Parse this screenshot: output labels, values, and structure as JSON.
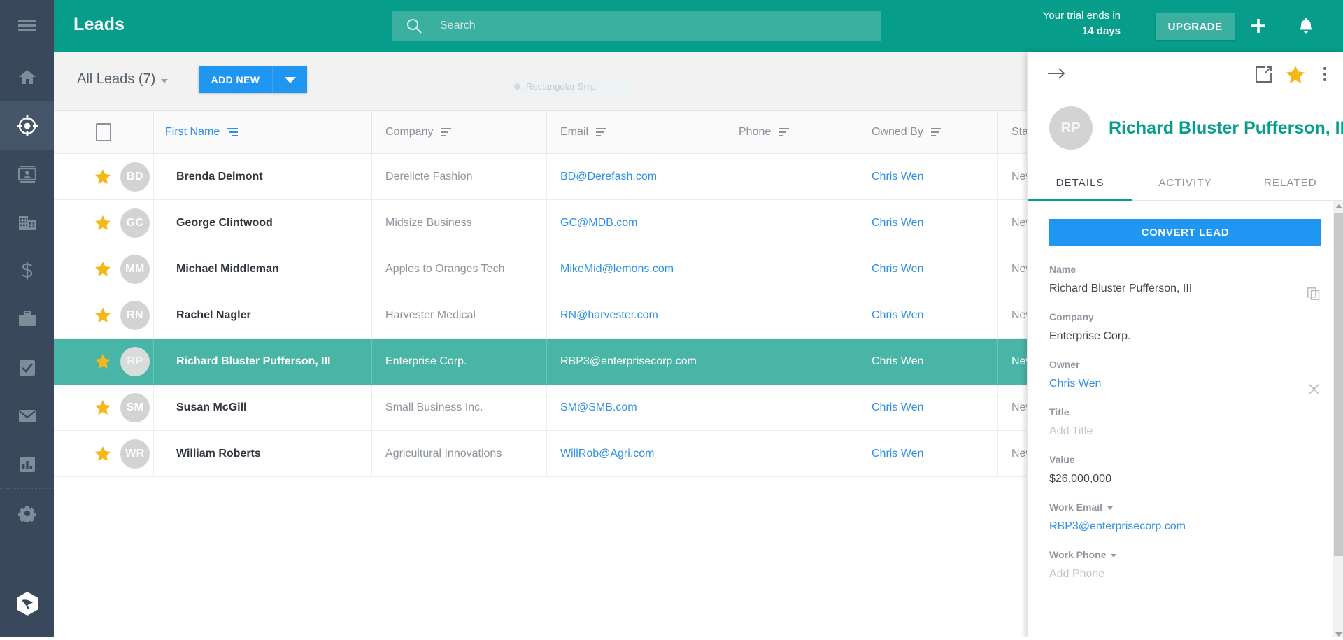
{
  "sidebar": {
    "items": [
      {
        "name": "menu-toggle",
        "icon": "hamburger-icon",
        "label": "Menu"
      },
      {
        "name": "home",
        "icon": "home-icon",
        "label": "Home"
      },
      {
        "name": "leads",
        "icon": "target-icon",
        "label": "Leads"
      },
      {
        "name": "contacts",
        "icon": "contact-card-icon",
        "label": "Contacts"
      },
      {
        "name": "accounts",
        "icon": "building-icon",
        "label": "Accounts"
      },
      {
        "name": "deals",
        "icon": "dollar-icon",
        "label": "Deals"
      },
      {
        "name": "projects",
        "icon": "briefcase-icon",
        "label": "Projects"
      },
      {
        "name": "tasks",
        "icon": "checkbox-icon",
        "label": "Tasks"
      },
      {
        "name": "email",
        "icon": "envelope-icon",
        "label": "Email"
      },
      {
        "name": "reports",
        "icon": "bar-chart-icon",
        "label": "Reports"
      },
      {
        "name": "settings",
        "icon": "gear-icon",
        "label": "Settings"
      },
      {
        "name": "logo",
        "icon": "leaf-hexagon-logo-icon",
        "label": "Logo"
      }
    ],
    "active": "leads",
    "bg_color": "#39485a",
    "active_bg_color": "#45556a"
  },
  "topbar": {
    "title": "Leads",
    "bg_color": "#069d8a",
    "search": {
      "value": "",
      "placeholder": "Search",
      "icon": "search-icon"
    },
    "trial_line1": "Your trial ends in",
    "trial_line2": "14 days",
    "upgrade_label": "UPGRADE",
    "plus_icon": "plus-icon",
    "bell_icon": "bell-icon"
  },
  "toolbar": {
    "view_label": "All Leads (7)",
    "add_new_label": "ADD NEW",
    "add_new_caret_icon": "chevron-down-icon",
    "accent_color": "#1e96f2",
    "snip_overlay_label": "Rectangular Snip"
  },
  "table": {
    "columns": [
      {
        "key": "check",
        "label": "",
        "sorted": false
      },
      {
        "key": "first_name",
        "label": "First Name",
        "sorted": true
      },
      {
        "key": "company",
        "label": "Company",
        "sorted": false
      },
      {
        "key": "email",
        "label": "Email",
        "sorted": false
      },
      {
        "key": "phone",
        "label": "Phone",
        "sorted": false
      },
      {
        "key": "owned_by",
        "label": "Owned By",
        "sorted": false
      },
      {
        "key": "status",
        "label": "Status",
        "sorted": false
      }
    ],
    "rows": [
      {
        "initials": "BD",
        "name": "Brenda Delmont",
        "company": "Derelicte Fashion",
        "email": "BD@Derefash.com",
        "phone": "",
        "owner": "Chris Wen",
        "status": "New",
        "starred": true,
        "selected": false
      },
      {
        "initials": "GC",
        "name": "George Clintwood",
        "company": "Midsize Business",
        "email": "GC@MDB.com",
        "phone": "",
        "owner": "Chris Wen",
        "status": "New",
        "starred": true,
        "selected": false
      },
      {
        "initials": "MM",
        "name": "Michael Middleman",
        "company": "Apples to Oranges Tech",
        "email": "MikeMid@lemons.com",
        "phone": "",
        "owner": "Chris Wen",
        "status": "New",
        "starred": true,
        "selected": false
      },
      {
        "initials": "RN",
        "name": "Rachel Nagler",
        "company": "Harvester Medical",
        "email": "RN@harvester.com",
        "phone": "",
        "owner": "Chris Wen",
        "status": "New",
        "starred": true,
        "selected": false
      },
      {
        "initials": "RP",
        "name": "Richard Bluster Pufferson, III",
        "company": "Enterprise Corp.",
        "email": "RBP3@enterprisecorp.com",
        "phone": "",
        "owner": "Chris Wen",
        "status": "New",
        "starred": true,
        "selected": true
      },
      {
        "initials": "SM",
        "name": "Susan McGill",
        "company": "Small Business Inc.",
        "email": "SM@SMB.com",
        "phone": "",
        "owner": "Chris Wen",
        "status": "New",
        "starred": true,
        "selected": false
      },
      {
        "initials": "WR",
        "name": "William Roberts",
        "company": "Agricultural Innovations",
        "email": "WillRob@Agri.com",
        "phone": "",
        "owner": "Chris Wen",
        "status": "New",
        "starred": true,
        "selected": false
      }
    ],
    "selected_row_color": "#49b5a6",
    "link_color": "#2f90e8"
  },
  "panel": {
    "back_icon": "arrow-right-icon",
    "open_icon": "open-in-new-icon",
    "star_icon": "star-icon",
    "more_icon": "more-vertical-icon",
    "avatar_initials": "RP",
    "record_name": "Richard Bluster Pufferson, III",
    "name_color": "#069d8a",
    "tabs": [
      {
        "label": "DETAILS",
        "active": true
      },
      {
        "label": "ACTIVITY",
        "active": false
      },
      {
        "label": "RELATED",
        "active": false
      }
    ],
    "convert_label": "CONVERT LEAD",
    "fields": [
      {
        "label": "Name",
        "value": "Richard Bluster Pufferson, III",
        "kind": "text",
        "action_icon": "copy-icon",
        "dropdown": false
      },
      {
        "label": "Company",
        "value": "Enterprise Corp.",
        "kind": "text",
        "action_icon": "",
        "dropdown": false
      },
      {
        "label": "Owner",
        "value": "Chris Wen",
        "kind": "link",
        "action_icon": "close-icon",
        "dropdown": false
      },
      {
        "label": "Title",
        "value": "Add Title",
        "kind": "placeholder",
        "action_icon": "",
        "dropdown": false
      },
      {
        "label": "Value",
        "value": "$26,000,000",
        "kind": "text",
        "action_icon": "",
        "dropdown": false
      },
      {
        "label": "Work Email",
        "value": "RBP3@enterprisecorp.com",
        "kind": "link",
        "action_icon": "",
        "dropdown": true
      },
      {
        "label": "Work Phone",
        "value": "Add Phone",
        "kind": "placeholder",
        "action_icon": "",
        "dropdown": true
      }
    ]
  }
}
